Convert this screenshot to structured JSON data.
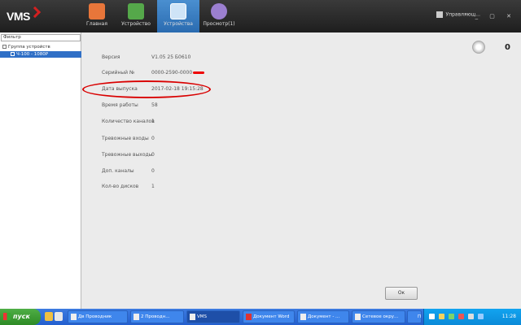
{
  "app": {
    "logo": "VMS",
    "modules": [
      {
        "label": "Главная",
        "active": false,
        "icon": "home-icon",
        "color": "#e8763a"
      },
      {
        "label": "Устройство",
        "active": false,
        "icon": "device-icon",
        "color": "#55a84a"
      },
      {
        "label": "Устройства",
        "active": true,
        "icon": "config-icon",
        "color": "#7fb6e8"
      },
      {
        "label": "Просмотр(1)",
        "active": false,
        "icon": "preview-icon",
        "color": "#9b7fd0"
      }
    ],
    "user": "Управляющ...",
    "window_controls": "_ ▢ ✕"
  },
  "tree": {
    "search_placeholder": "Фильтр",
    "root": "Группа устройств",
    "selected_item": "Ч-100 - 1080Р"
  },
  "device_info": {
    "rows": [
      {
        "label": "Версия",
        "value": "V1.05 25 Б0610"
      },
      {
        "label": "Серийный №",
        "value": "0000-2590-0000"
      },
      {
        "label": "Дата выпуска",
        "value": "2017-02-18 19:15:28"
      },
      {
        "label": "Время работы",
        "value": "58"
      },
      {
        "label": "Количество каналов",
        "value": "1"
      },
      {
        "label": "Тревожные входы",
        "value": "0"
      },
      {
        "label": "Тревожные выходы",
        "value": "0"
      },
      {
        "label": "Доп. каналы",
        "value": "0"
      },
      {
        "label": "Кол-во дисков",
        "value": "1"
      }
    ],
    "highlighted_row": 2,
    "highlight_color": "#d90000"
  },
  "alarm": {
    "icon": "alarm-bell-icon",
    "count": "0"
  },
  "ok_button": "Ок",
  "taskbar": {
    "start": "пуск",
    "tasks": [
      {
        "label": "Дв Проводник",
        "active": false
      },
      {
        "label": "2 Проводн...",
        "active": false
      },
      {
        "label": "VMS",
        "active": true
      },
      {
        "label": "Документ Word",
        "active": false
      },
      {
        "label": "Документ - ...",
        "active": false
      },
      {
        "label": "Сетевое окру...",
        "active": false
      },
      {
        "label": "П",
        "active": false
      }
    ],
    "clock": "11:28"
  }
}
